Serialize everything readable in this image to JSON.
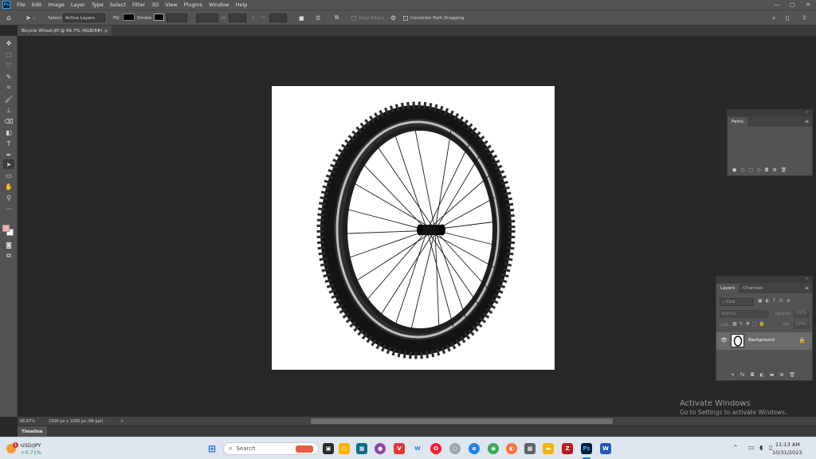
{
  "menubar": {
    "logo": "Ps",
    "items": [
      "File",
      "Edit",
      "Image",
      "Layer",
      "Type",
      "Select",
      "Filter",
      "3D",
      "View",
      "Plugins",
      "Window",
      "Help"
    ],
    "minimize": "—",
    "maximize": "▢",
    "close": "✕"
  },
  "options": {
    "select_label": "Select:",
    "select_value": "Active Layers",
    "fill_label": "Fill:",
    "stroke_label": "Stroke:",
    "w_label": "W:",
    "h_label": "H:",
    "align_edges": "Align Edges",
    "constrain": "Constrain Path Dragging"
  },
  "document": {
    "tab_title": "Bicycle Wheel.jfif @ 66.7% (RGB/8#)",
    "tab_close": "×"
  },
  "paths_panel": {
    "tab": "Paths"
  },
  "layers_panel": {
    "tabs": [
      "Layers",
      "Channels"
    ],
    "kind_placeholder": "Kind",
    "blend_mode": "Normal",
    "opacity_label": "Opacity:",
    "opacity_value": "100%",
    "lock_label": "Lock:",
    "fill_label": "Fill:",
    "fill_value": "100%",
    "layer_name": "Background"
  },
  "status": {
    "zoom": "66.67%",
    "doc_info": "1000 px x 1000 px (96 ppi)",
    "arrow": ">"
  },
  "timeline": {
    "label": "Timeline"
  },
  "watermark": {
    "title": "Activate Windows",
    "subtitle": "Go to Settings to activate Windows."
  },
  "taskbar": {
    "ticker_symbol": "USD/JPY",
    "ticker_change": "+0.71%",
    "ticker_badge": "1",
    "search_placeholder": "Search",
    "time": "11:13 AM",
    "date": "10/31/2023"
  },
  "colors": {
    "foreground_swatch": "#f4a9a8",
    "background_swatch": "#ffffff",
    "ticker_up": "#2e8b57"
  }
}
